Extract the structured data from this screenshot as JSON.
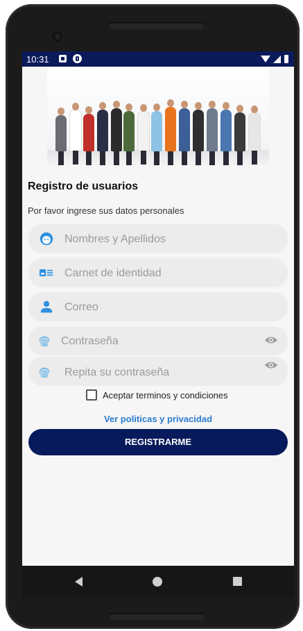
{
  "status_bar": {
    "time": "10:31"
  },
  "form": {
    "title": "Registro de usuarios",
    "subtitle": "Por favor ingrese sus datos personales",
    "fields": [
      {
        "placeholder": "Nombres y Apellidos",
        "icon": "face-icon"
      },
      {
        "placeholder": "Carnet de identidad",
        "icon": "id-card-icon"
      },
      {
        "placeholder": "Correo",
        "icon": "person-icon"
      },
      {
        "placeholder": "Contraseña",
        "icon": "fingerprint-icon",
        "trailing_icon": "eye-icon"
      },
      {
        "placeholder": "Repita su contraseña",
        "icon": "fingerprint-icon",
        "trailing_icon": "eye-icon"
      }
    ],
    "terms_label": "Aceptar terminos y condiciones",
    "terms_checked": false,
    "policy_link": "Ver politicas y privacidad",
    "submit_label": "REGISTRARME"
  },
  "colors": {
    "status_bar": "#0b1a5a",
    "button": "#071a5c",
    "link": "#2b7bd0",
    "icon_accent": "#2e8fe0",
    "field_bg": "#ececec"
  },
  "nav_bar": {
    "icons": [
      "back-icon",
      "home-icon",
      "recent-apps-icon"
    ]
  }
}
